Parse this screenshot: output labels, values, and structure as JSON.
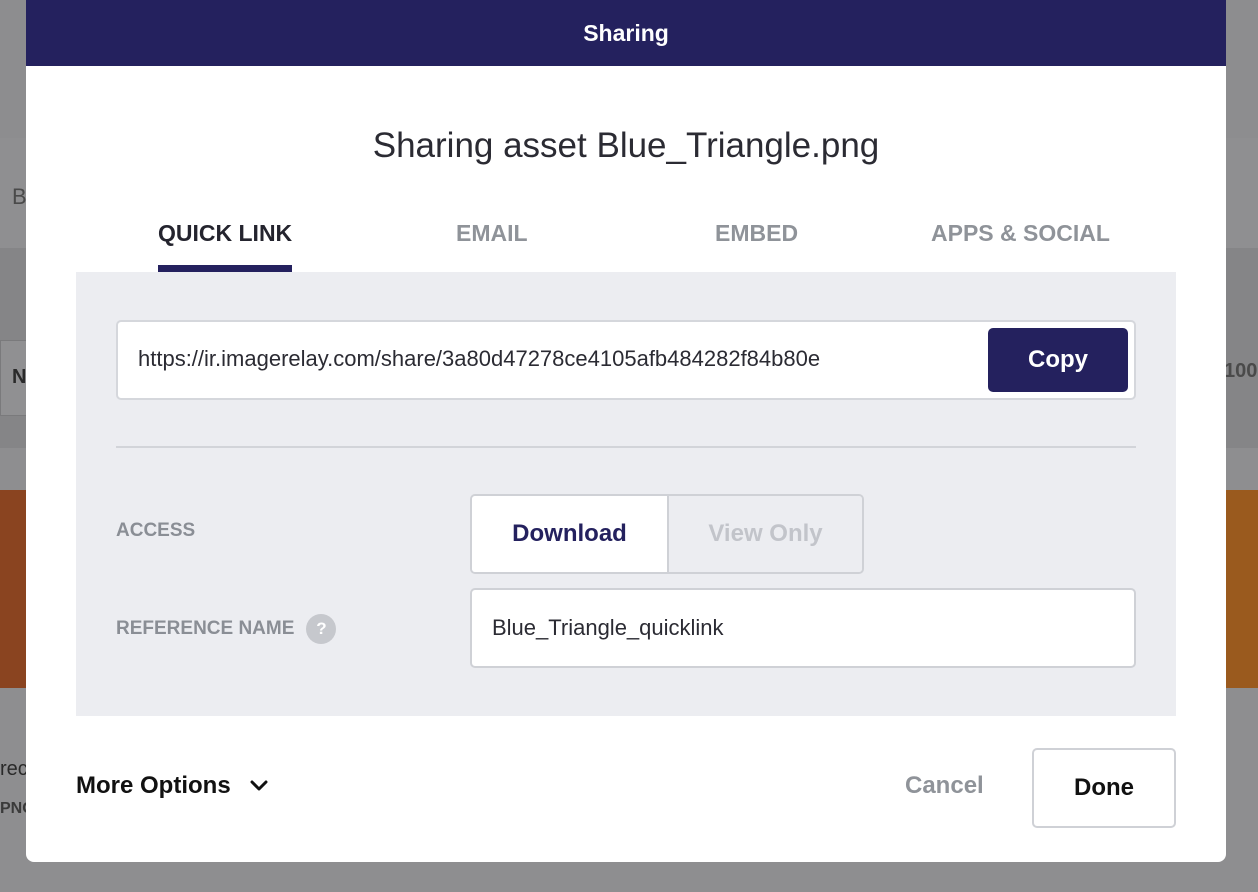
{
  "background": {
    "fragments": [
      "B",
      "N",
      "100",
      "rec",
      "PNG"
    ]
  },
  "modal": {
    "header_title": "Sharing",
    "title": "Sharing asset Blue_Triangle.png",
    "tabs": [
      {
        "label": "QUICK LINK",
        "active": true
      },
      {
        "label": "EMAIL",
        "active": false
      },
      {
        "label": "EMBED",
        "active": false
      },
      {
        "label": "APPS & SOCIAL",
        "active": false
      }
    ],
    "quick_link": {
      "url": "https://ir.imagerelay.com/share/3a80d47278ce4105afb484282f84b80e",
      "copy_label": "Copy",
      "access_label": "ACCESS",
      "access_options": [
        "Download",
        "View Only"
      ],
      "access_selected": "Download",
      "reference_label": "REFERENCE NAME",
      "help_glyph": "?",
      "reference_value": "Blue_Triangle_quicklink"
    },
    "footer": {
      "more_options": "More Options",
      "cancel": "Cancel",
      "done": "Done"
    }
  },
  "colors": {
    "brand": "#24215e",
    "muted_text": "#8f9399",
    "panel_bg": "#ecedf1"
  },
  "icons": [
    "help-icon",
    "chevron-down-icon"
  ]
}
